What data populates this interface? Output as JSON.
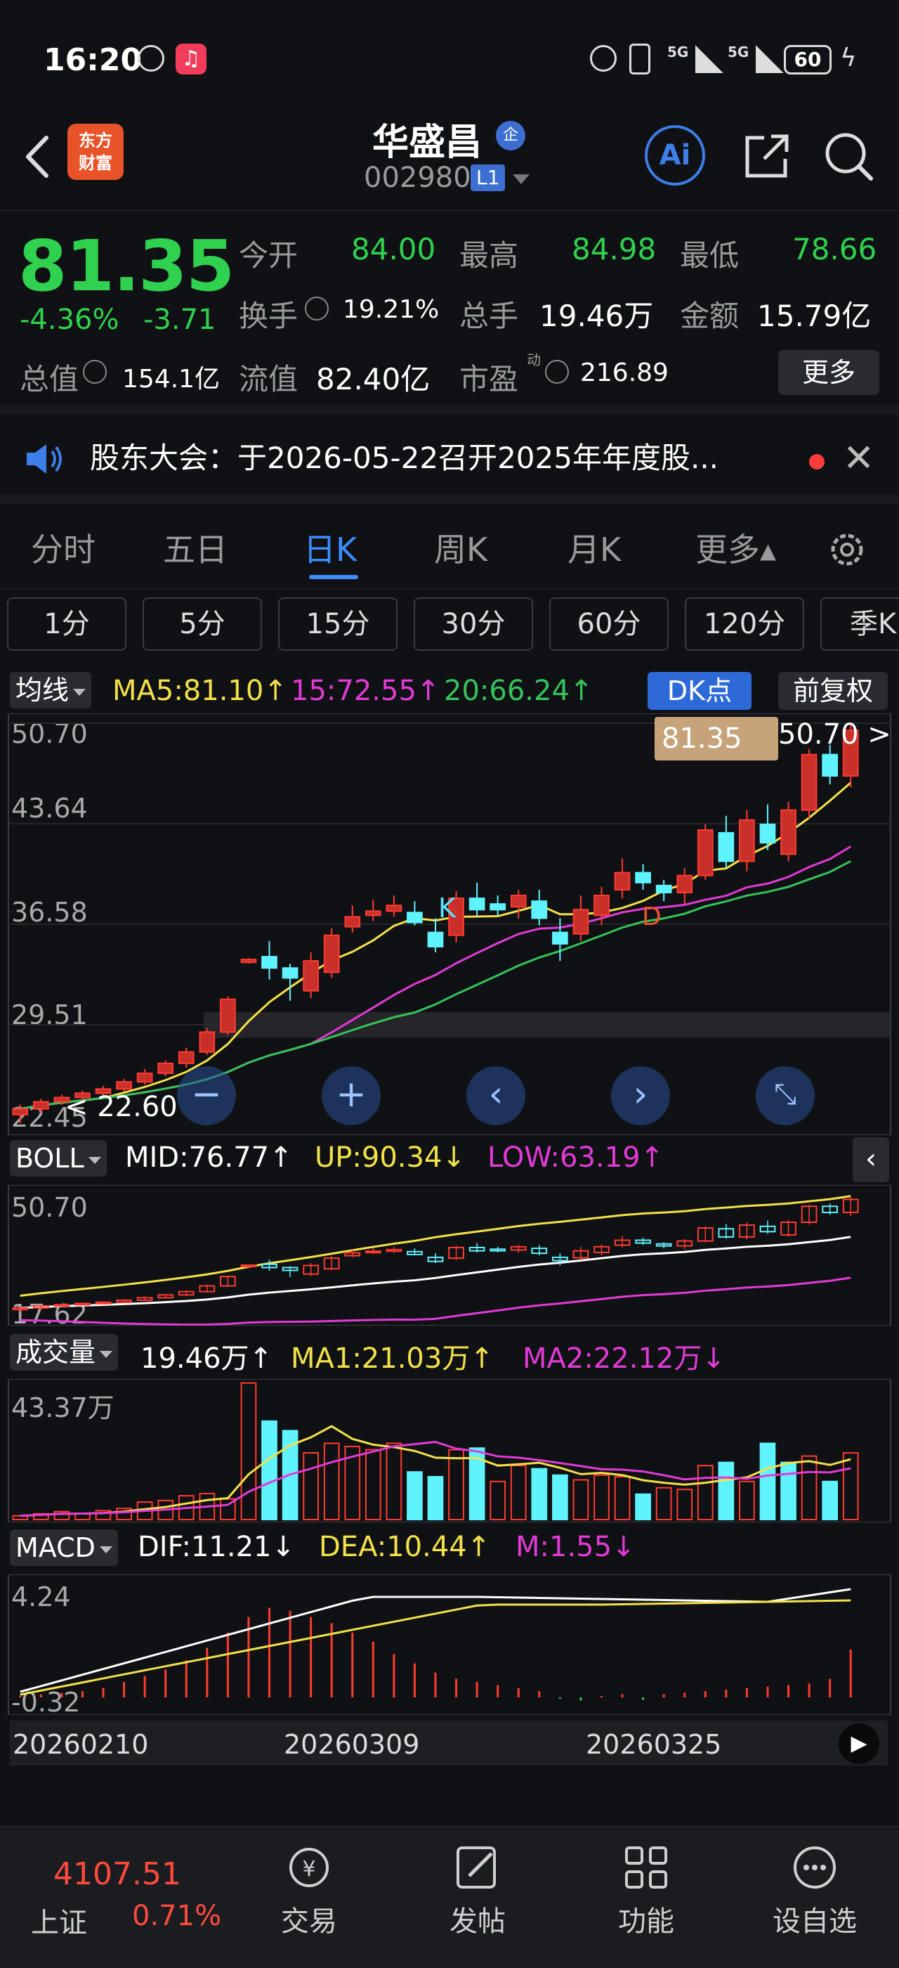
{
  "status": {
    "time": "16:20",
    "battery": "60",
    "signal1": "5G",
    "signal2": "5G"
  },
  "header": {
    "back": "<",
    "logo_line1": "东方",
    "logo_line2": "财富",
    "name": "华盛昌",
    "name_badge": "企",
    "code": "002980",
    "level": "L1",
    "ai_label": "Ai"
  },
  "quote": {
    "price": "81.35",
    "change_pct": "-4.36%",
    "change_abs": "-3.71",
    "open_label": "今开",
    "open": "84.00",
    "high_label": "最高",
    "high": "84.98",
    "low_label": "最低",
    "low": "78.66",
    "turnover_label": "换手",
    "turnover": "19.21%",
    "volume_label": "总手",
    "volume": "19.46万",
    "amount_label": "金额",
    "amount": "15.79亿",
    "mcap_label": "总值",
    "mcap": "154.1亿",
    "float_label": "流值",
    "float_val": "82.40亿",
    "pe_label": "市盈",
    "pe_sup": "动",
    "pe": "216.89",
    "more": "更多"
  },
  "notice": {
    "text": "股东大会：于2026-05-22召开2025年年度股..."
  },
  "period_tabs": [
    "分时",
    "五日",
    "日K",
    "周K",
    "月K",
    "更多▴"
  ],
  "active_period": "日K",
  "minute_tabs": [
    "1分",
    "5分",
    "15分",
    "30分",
    "60分",
    "120分",
    "季K"
  ],
  "ma_header": {
    "label": "均线",
    "ma5": "MA5:81.10↑",
    "ma15": "15:72.55↑",
    "ma20": "20:66.24↑",
    "dk": "DK点",
    "fq": "前复权"
  },
  "main_axis": [
    "50.70",
    "43.64",
    "36.58",
    "29.51",
    "22.45"
  ],
  "price_tag": "81.35",
  "high_marker": "50.70",
  "low_marker": "22.60",
  "k_marker": "K",
  "d_marker": "D",
  "boll_header": {
    "label": "BOLL",
    "mid": "MID:76.77↑",
    "up": "UP:90.34↓",
    "low": "LOW:63.19↑"
  },
  "boll_axis": [
    "50.70",
    "17.62"
  ],
  "vol_header": {
    "label": "成交量",
    "vol": "19.46万↑",
    "ma1": "MA1:21.03万↑",
    "ma2": "MA2:22.12万↓"
  },
  "vol_axis": [
    "43.37万"
  ],
  "macd_header": {
    "label": "MACD",
    "dif": "DIF:11.21↓",
    "dea": "DEA:10.44↑",
    "m": "M:1.55↓"
  },
  "macd_axis": [
    "4.24",
    "-0.32"
  ],
  "dates": [
    "20260210",
    "20260309",
    "20260325"
  ],
  "bottom_nav": {
    "index_value": "4107.51",
    "index_name": "上证",
    "index_change": "0.71%",
    "items": [
      "交易",
      "发帖",
      "功能",
      "设自选"
    ]
  },
  "chart_data": {
    "type": "candlestick",
    "ma_lines": [
      "MA5",
      "15",
      "20"
    ],
    "axis_range": [
      22.45,
      50.7
    ],
    "candles": [
      {
        "o": 23.2,
        "c": 23.6,
        "h": 23.9,
        "l": 22.6,
        "up": true
      },
      {
        "o": 23.6,
        "c": 24.1,
        "h": 24.3,
        "l": 23.3,
        "up": true
      },
      {
        "o": 24.1,
        "c": 24.4,
        "h": 24.6,
        "l": 23.9,
        "up": true
      },
      {
        "o": 24.4,
        "c": 24.7,
        "h": 24.9,
        "l": 24.2,
        "up": true
      },
      {
        "o": 24.7,
        "c": 25.0,
        "h": 25.2,
        "l": 24.5,
        "up": true
      },
      {
        "o": 25.0,
        "c": 25.5,
        "h": 25.7,
        "l": 24.8,
        "up": true
      },
      {
        "o": 25.5,
        "c": 26.1,
        "h": 26.4,
        "l": 25.3,
        "up": true
      },
      {
        "o": 26.1,
        "c": 26.8,
        "h": 27.0,
        "l": 25.9,
        "up": true
      },
      {
        "o": 26.8,
        "c": 27.6,
        "h": 27.9,
        "l": 26.5,
        "up": true
      },
      {
        "o": 27.6,
        "c": 29.0,
        "h": 29.3,
        "l": 27.4,
        "up": true
      },
      {
        "o": 29.0,
        "c": 31.3,
        "h": 31.5,
        "l": 28.8,
        "up": true
      },
      {
        "o": 33.9,
        "c": 34.1,
        "h": 34.2,
        "l": 33.8,
        "up": true
      },
      {
        "o": 34.3,
        "c": 33.5,
        "h": 35.4,
        "l": 32.7,
        "up": false
      },
      {
        "o": 33.5,
        "c": 32.8,
        "h": 33.8,
        "l": 31.2,
        "up": false
      },
      {
        "o": 31.9,
        "c": 34.0,
        "h": 34.6,
        "l": 31.4,
        "up": true
      },
      {
        "o": 33.2,
        "c": 35.8,
        "h": 36.3,
        "l": 32.8,
        "up": true
      },
      {
        "o": 36.4,
        "c": 37.1,
        "h": 37.9,
        "l": 36.0,
        "up": true
      },
      {
        "o": 37.2,
        "c": 37.5,
        "h": 38.3,
        "l": 36.8,
        "up": true
      },
      {
        "o": 37.5,
        "c": 37.9,
        "h": 38.6,
        "l": 37.1,
        "up": true
      },
      {
        "o": 37.4,
        "c": 36.7,
        "h": 38.2,
        "l": 36.5,
        "up": false
      },
      {
        "o": 36.0,
        "c": 35.0,
        "h": 37.0,
        "l": 34.6,
        "up": false
      },
      {
        "o": 35.8,
        "c": 38.4,
        "h": 38.9,
        "l": 35.3,
        "up": true
      },
      {
        "o": 38.4,
        "c": 37.6,
        "h": 39.5,
        "l": 37.2,
        "up": false
      },
      {
        "o": 37.6,
        "c": 38.0,
        "h": 38.6,
        "l": 37.2,
        "up": false
      },
      {
        "o": 37.8,
        "c": 38.6,
        "h": 39.0,
        "l": 37.0,
        "up": true
      },
      {
        "o": 38.2,
        "c": 37.0,
        "h": 39.0,
        "l": 36.5,
        "up": false
      },
      {
        "o": 36.0,
        "c": 35.2,
        "h": 37.0,
        "l": 34.0,
        "up": false
      },
      {
        "o": 35.9,
        "c": 37.6,
        "h": 38.6,
        "l": 35.4,
        "up": true
      },
      {
        "o": 37.2,
        "c": 38.6,
        "h": 39.2,
        "l": 36.5,
        "up": true
      },
      {
        "o": 39.0,
        "c": 40.2,
        "h": 41.2,
        "l": 38.4,
        "up": true
      },
      {
        "o": 40.2,
        "c": 39.5,
        "h": 40.8,
        "l": 39.0,
        "up": false
      },
      {
        "o": 39.3,
        "c": 38.8,
        "h": 39.7,
        "l": 38.2,
        "up": false
      },
      {
        "o": 38.8,
        "c": 40.0,
        "h": 40.5,
        "l": 38.0,
        "up": true
      },
      {
        "o": 40.0,
        "c": 43.2,
        "h": 43.6,
        "l": 39.7,
        "up": true
      },
      {
        "o": 43.0,
        "c": 41.0,
        "h": 44.2,
        "l": 40.6,
        "up": false
      },
      {
        "o": 41.0,
        "c": 43.9,
        "h": 44.6,
        "l": 40.3,
        "up": true
      },
      {
        "o": 43.6,
        "c": 42.3,
        "h": 45.0,
        "l": 41.8,
        "up": false
      },
      {
        "o": 41.5,
        "c": 44.6,
        "h": 45.2,
        "l": 41.0,
        "up": true
      },
      {
        "o": 44.6,
        "c": 48.5,
        "h": 48.9,
        "l": 44.0,
        "up": true
      },
      {
        "o": 48.5,
        "c": 47.0,
        "h": 49.2,
        "l": 46.4,
        "up": false
      },
      {
        "o": 47.0,
        "c": 50.2,
        "h": 50.7,
        "l": 46.2,
        "up": true
      }
    ],
    "volume": [
      {
        "v": 1.2,
        "up": true
      },
      {
        "v": 1.8,
        "up": true
      },
      {
        "v": 2.5,
        "up": true
      },
      {
        "v": 2.0,
        "up": true
      },
      {
        "v": 2.8,
        "up": true
      },
      {
        "v": 3.5,
        "up": true
      },
      {
        "v": 5.5,
        "up": true
      },
      {
        "v": 6.0,
        "up": true
      },
      {
        "v": 7.5,
        "up": true
      },
      {
        "v": 8.2,
        "up": true
      },
      {
        "v": 6.5,
        "up": true
      },
      {
        "v": 43.0,
        "up": true
      },
      {
        "v": 31.0,
        "up": false
      },
      {
        "v": 28.0,
        "up": false
      },
      {
        "v": 21.0,
        "up": true
      },
      {
        "v": 24.0,
        "up": true
      },
      {
        "v": 23.0,
        "up": true
      },
      {
        "v": 22.0,
        "up": true
      },
      {
        "v": 24.0,
        "up": true
      },
      {
        "v": 15.0,
        "up": false
      },
      {
        "v": 13.5,
        "up": false
      },
      {
        "v": 22.0,
        "up": true
      },
      {
        "v": 22.5,
        "up": false
      },
      {
        "v": 12.0,
        "up": true
      },
      {
        "v": 17.0,
        "up": true
      },
      {
        "v": 16.0,
        "up": false
      },
      {
        "v": 14.0,
        "up": false
      },
      {
        "v": 12.5,
        "up": true
      },
      {
        "v": 14.0,
        "up": true
      },
      {
        "v": 13.5,
        "up": true
      },
      {
        "v": 8.0,
        "up": false
      },
      {
        "v": 10.0,
        "up": true
      },
      {
        "v": 9.5,
        "up": true
      },
      {
        "v": 17.0,
        "up": true
      },
      {
        "v": 18.0,
        "up": false
      },
      {
        "v": 12.0,
        "up": true
      },
      {
        "v": 24.0,
        "up": false
      },
      {
        "v": 18.0,
        "up": false
      },
      {
        "v": 20.0,
        "up": true
      },
      {
        "v": 12.0,
        "up": false
      },
      {
        "v": 21.0,
        "up": true
      }
    ],
    "macd_bars": [
      0.05,
      0.1,
      0.15,
      0.2,
      0.3,
      0.5,
      0.7,
      0.9,
      1.2,
      1.6,
      2.1,
      2.6,
      2.9,
      2.8,
      2.6,
      2.4,
      2.1,
      1.8,
      1.4,
      1.1,
      0.8,
      0.6,
      0.5,
      0.4,
      0.3,
      0.2,
      -0.05,
      -0.1,
      0.05,
      0.1,
      -0.08,
      0.1,
      0.15,
      0.2,
      0.25,
      0.3,
      0.35,
      0.4,
      0.45,
      0.6,
      1.55
    ]
  }
}
